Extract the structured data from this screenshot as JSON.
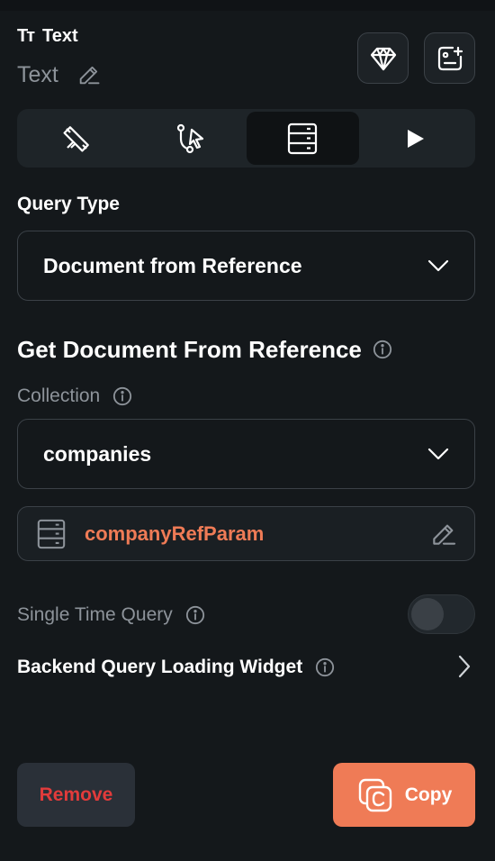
{
  "widget": {
    "type_icon": "Tт",
    "type_label": "Text",
    "name": "Text"
  },
  "tabs": [
    {
      "icon": "design-ruler-icon",
      "active": false
    },
    {
      "icon": "actions-flow-icon",
      "active": false
    },
    {
      "icon": "backend-query-icon",
      "active": true
    },
    {
      "icon": "play-icon",
      "active": false
    }
  ],
  "query_type": {
    "label": "Query Type",
    "value": "Document from Reference"
  },
  "section": {
    "title": "Get Document From Reference"
  },
  "collection": {
    "label": "Collection",
    "value": "companies"
  },
  "reference": {
    "value": "companyRefParam"
  },
  "single_time_query": {
    "label": "Single Time Query",
    "enabled": false
  },
  "loading_widget": {
    "label": "Backend Query Loading Widget"
  },
  "actions": {
    "remove_label": "Remove",
    "copy_label": "Copy"
  },
  "colors": {
    "background": "#14181b",
    "accent": "#ef7b56",
    "danger": "#e23b3b",
    "muted_text": "#8d939a"
  }
}
